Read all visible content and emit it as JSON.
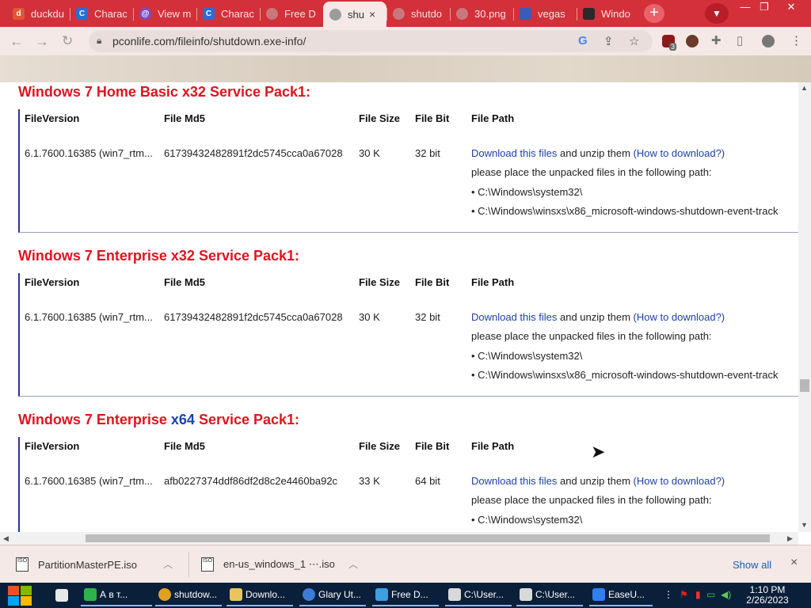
{
  "browser": {
    "tabs": [
      {
        "title": "duckdu",
        "icon": "duckduckgo-icon",
        "color": "#de5833"
      },
      {
        "title": "Charac",
        "icon": "site-icon",
        "color": "#2b6cd6"
      },
      {
        "title": "View m",
        "icon": "at-sign-icon",
        "color": "#7a4cc7"
      },
      {
        "title": "Charac",
        "icon": "site-icon",
        "color": "#2b6cd6"
      },
      {
        "title": "Free D",
        "icon": "globe-icon",
        "color": "#c9777c"
      },
      {
        "title": "shu",
        "icon": "globe-icon",
        "color": "#9c9c9c",
        "active": true
      },
      {
        "title": "shutdo",
        "icon": "globe-icon",
        "color": "#c9777c"
      },
      {
        "title": "30.png",
        "icon": "globe-icon",
        "color": "#c9777c"
      },
      {
        "title": "vegas",
        "icon": "image-icon",
        "color": "#3a5bb8"
      },
      {
        "title": "Windo",
        "icon": "windows-site-icon",
        "color": "#2a2a2a"
      }
    ],
    "new_tab_label": "+",
    "close_glyph": "×",
    "url": "pconlife.com/fileinfo/shutdown.exe-info/",
    "extension_badge": "3",
    "accent": "#d3303a"
  },
  "sections": [
    {
      "title_pre": "Windows 7 Home Basic ",
      "title_arch": "x32",
      "title_post": " Service Pack1:",
      "arch_color": "red",
      "headers": {
        "version": "FileVersion",
        "md5": "File Md5",
        "size": "File Size",
        "bit": "File Bit",
        "path": "File Path"
      },
      "row": {
        "version": "6.1.7600.16385 (win7_rtm...",
        "md5": "61739432482891f2dc5745cca0a67028",
        "size": "30 K",
        "bit": "32 bit",
        "download_link": "Download this files",
        "unzip_text": " and unzip them ",
        "howto_link": "(How to download?)",
        "place_text": "please place the unpacked files in the following path:",
        "paths": [
          "• C:\\Windows\\system32\\",
          "• C:\\Windows\\winsxs\\x86_microsoft-windows-shutdown-event-track"
        ]
      }
    },
    {
      "title_pre": "Windows 7 Enterprise ",
      "title_arch": "x32",
      "title_post": " Service Pack1:",
      "arch_color": "red",
      "headers": {
        "version": "FileVersion",
        "md5": "File Md5",
        "size": "File Size",
        "bit": "File Bit",
        "path": "File Path"
      },
      "row": {
        "version": "6.1.7600.16385 (win7_rtm...",
        "md5": "61739432482891f2dc5745cca0a67028",
        "size": "30 K",
        "bit": "32 bit",
        "download_link": "Download this files",
        "unzip_text": " and unzip them ",
        "howto_link": "(How to download?)",
        "place_text": "please place the unpacked files in the following path:",
        "paths": [
          "• C:\\Windows\\system32\\",
          "• C:\\Windows\\winsxs\\x86_microsoft-windows-shutdown-event-track"
        ]
      }
    },
    {
      "title_pre": "Windows 7 Enterprise ",
      "title_arch": "x64",
      "title_post": " Service Pack1:",
      "arch_color": "blue",
      "headers": {
        "version": "FileVersion",
        "md5": "File Md5",
        "size": "File Size",
        "bit": "File Bit",
        "path": "File Path"
      },
      "row": {
        "version": "6.1.7600.16385 (win7_rtm...",
        "md5": "afb0227374ddf86df2d8c2e4460ba92c",
        "size": "33 K",
        "bit": "64 bit",
        "download_link": "Download this files",
        "unzip_text": " and unzip them ",
        "howto_link": "(How to download?)",
        "place_text": "please place the unpacked files in the following path:",
        "paths": [
          "• C:\\Windows\\system32\\"
        ]
      }
    }
  ],
  "downloads": {
    "items": [
      {
        "name": "PartitionMasterPE.iso",
        "icon": "iso-file-icon"
      },
      {
        "name": "en-us_windows_1 ⋯.iso",
        "icon": "iso-file-icon"
      }
    ],
    "show_all": "Show all",
    "close": "×"
  },
  "taskbar": {
    "items": [
      {
        "label": "",
        "icon": "desktop-icon",
        "color": "#e8e8e8"
      },
      {
        "label": "А в т...",
        "icon": "app-icon",
        "color": "#2fb24c"
      },
      {
        "label": "shutdow...",
        "icon": "chrome-icon",
        "color": "#e0a020"
      },
      {
        "label": "Downlo...",
        "icon": "folder-icon",
        "color": "#e8c45a"
      },
      {
        "label": "Glary Ut...",
        "icon": "glary-icon",
        "color": "#3d7bd6"
      },
      {
        "label": "Free D...",
        "icon": "free-download-icon",
        "color": "#3aa0e0"
      },
      {
        "label": "C:\\User...",
        "icon": "7zip-icon",
        "color": "#d9d9d9"
      },
      {
        "label": "C:\\User...",
        "icon": "7zip-icon",
        "color": "#d9d9d9"
      },
      {
        "label": "EaseU...",
        "icon": "easeus-icon",
        "color": "#2f80ed"
      }
    ],
    "time": "1:10 PM",
    "date": "2/26/2023"
  }
}
